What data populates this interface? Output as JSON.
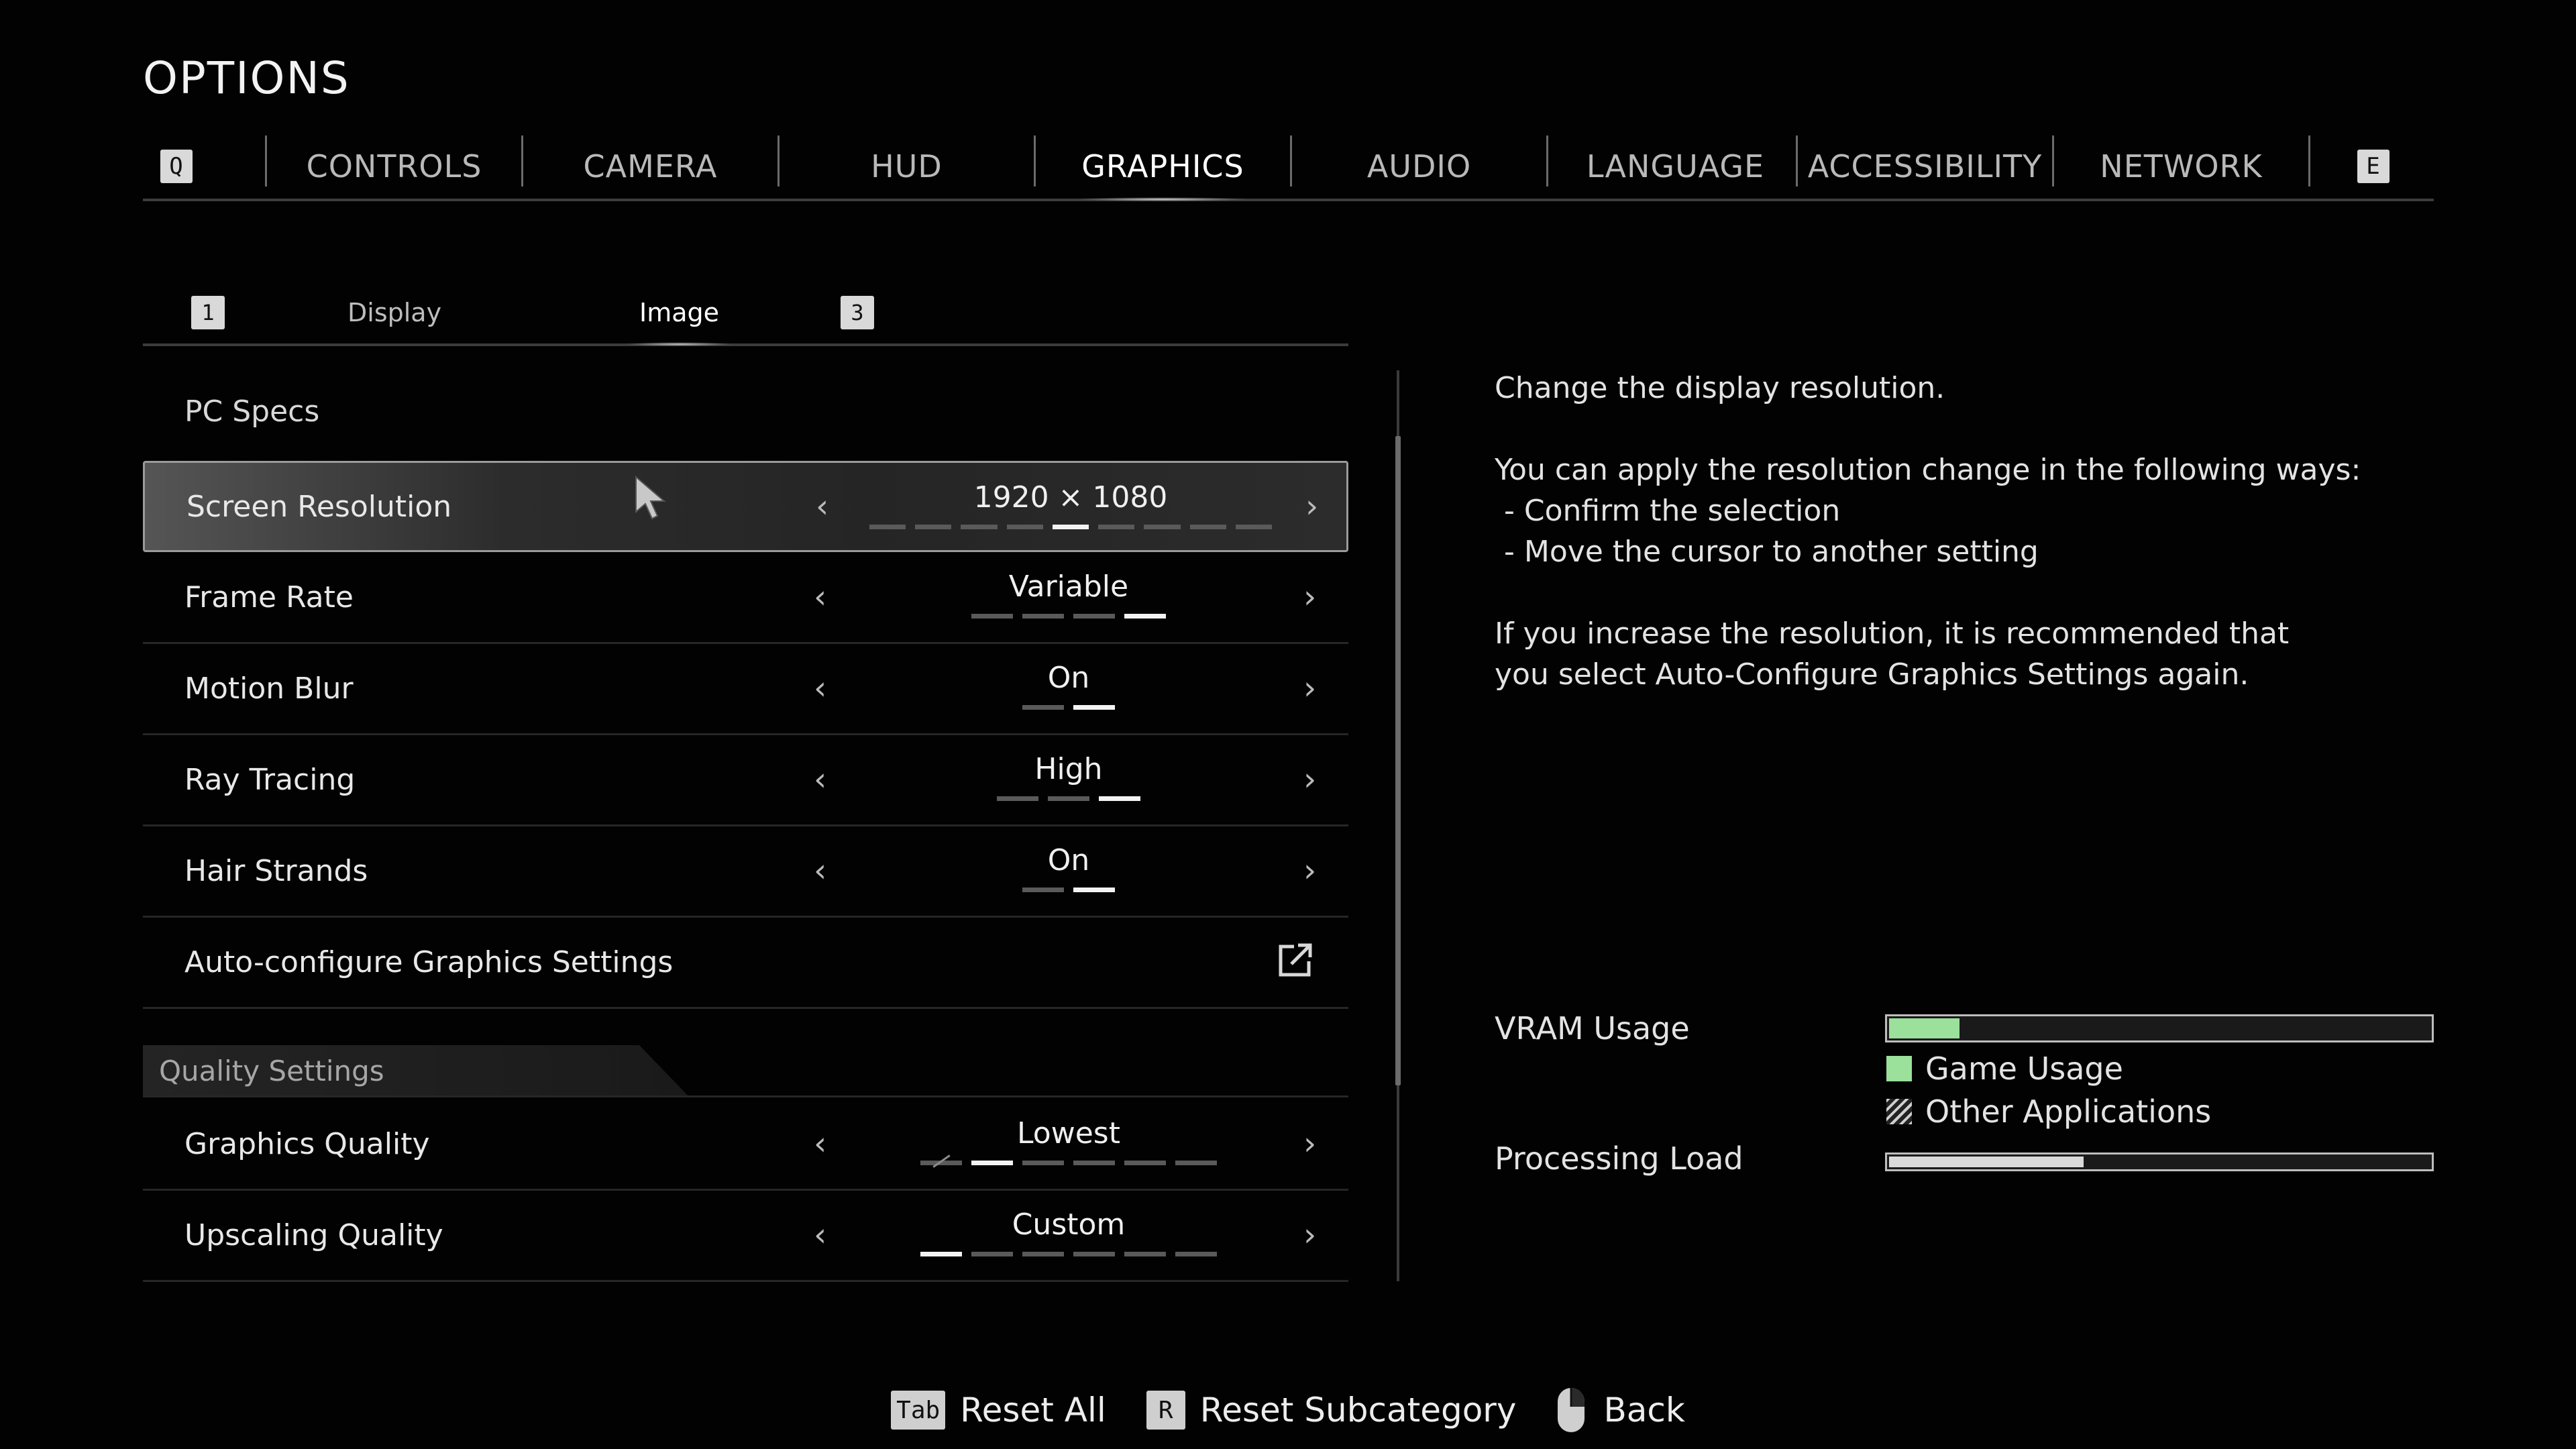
{
  "title": "OPTIONS",
  "top_tabs": {
    "left_key": "Q",
    "right_key": "E",
    "items": [
      "CONTROLS",
      "CAMERA",
      "HUD",
      "GRAPHICS",
      "AUDIO",
      "LANGUAGE",
      "ACCESSIBILITY",
      "NETWORK"
    ],
    "active": "GRAPHICS"
  },
  "sub_tabs": {
    "left_key": "1",
    "right_key": "3",
    "items": [
      "Display",
      "Image"
    ],
    "active": "Image"
  },
  "pc_specs": "PC Specs",
  "settings": [
    {
      "label": "Screen Resolution",
      "value": "1920 × 1080",
      "steps": 9,
      "active_step": 5,
      "selected": true
    },
    {
      "label": "Frame Rate",
      "value": "Variable",
      "steps": 4,
      "active_step": 4
    },
    {
      "label": "Motion Blur",
      "value": "On",
      "steps": 2,
      "active_step": 2
    },
    {
      "label": "Ray Tracing",
      "value": "High",
      "steps": 3,
      "active_step": 3
    },
    {
      "label": "Hair Strands",
      "value": "On",
      "steps": 2,
      "active_step": 2
    },
    {
      "label": "Auto-configure Graphics Settings",
      "icon": "external-link-icon"
    }
  ],
  "quality_header": "Quality Settings",
  "quality_settings": [
    {
      "label": "Graphics Quality",
      "value": "Lowest",
      "steps": 6,
      "active_step": 2
    },
    {
      "label": "Upscaling Quality",
      "value": "Custom",
      "steps": 6,
      "active_step": 1
    }
  ],
  "description": {
    "line1": "Change the display resolution.",
    "line2": "You can apply the resolution change in the following ways:",
    "bullet1": " - Confirm the selection",
    "bullet2": " - Move the cursor to another setting",
    "line3": "If you increase the resolution, it is recommended that",
    "line4": "you select Auto-Configure Graphics Settings again."
  },
  "stats": {
    "vram_label": "VRAM Usage",
    "vram_game_fraction": 0.13,
    "legend_game": "Game Usage",
    "legend_other": "Other Applications",
    "processing_label": "Processing Load",
    "processing_fraction": 0.36
  },
  "footer": {
    "reset_all_key": "Tab",
    "reset_all_label": "Reset All",
    "reset_sub_key": "R",
    "reset_sub_label": "Reset Subcategory",
    "back_label": "Back"
  },
  "colors": {
    "game_usage": "#9be09b",
    "background": "#020202"
  }
}
